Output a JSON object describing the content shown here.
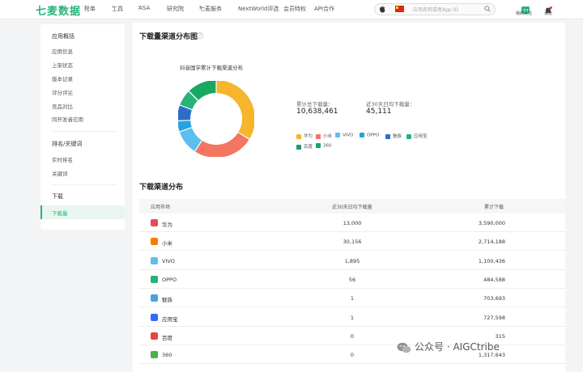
{
  "header": {
    "logo": "七麦数据",
    "nav": [
      "榜单",
      "工具",
      "ASA",
      "研究院",
      "七麦服务",
      "NextWorld评选",
      "会员特权",
      "API合作"
    ],
    "search_placeholder": "应用名称或者App ID",
    "my_follow": "我的关注",
    "messages": "消息",
    "follow_badge": "10"
  },
  "sidebar": {
    "group1_title": "应用概括",
    "group1_items": [
      "应用信息",
      "上架状态",
      "版本记录",
      "评分评论",
      "竞品对比",
      "同开发者应用"
    ],
    "group2_title": "排名/关键词",
    "group2_items": [
      "实时排名",
      "关键词"
    ],
    "group3_title": "下载",
    "group3_items": [
      "下载量"
    ]
  },
  "main": {
    "section1_title": "下载量渠道分布图",
    "chart_title": "抖音国学累计下载渠道分布",
    "total_label": "累计总下载量：",
    "total_value": "10,638,461",
    "avg_label": "近30天日均下载量：",
    "avg_value": "45,111",
    "section2_title": "下载渠道分布"
  },
  "chart_data": {
    "type": "pie",
    "title": "抖音国学累计下载渠道分布",
    "categories": [
      "华为",
      "小米",
      "VIVO",
      "OPPO",
      "魅族",
      "应用宝",
      "百度",
      "360"
    ],
    "values": [
      3590000,
      2714188,
      1100436,
      484588,
      703693,
      727598,
      315,
      1317643
    ],
    "colors": [
      "#f7b52b",
      "#f47560",
      "#5bbfef",
      "#26a4e0",
      "#2a6fc7",
      "#26b37a",
      "#1d9b6c",
      "#17a862"
    ]
  },
  "table": {
    "headers": [
      "应用市场",
      "近30天日均下载量",
      "累计下载"
    ],
    "rows": [
      {
        "name": "华为",
        "avg": "13,000",
        "total": "3,590,000",
        "color": "#e84a5f"
      },
      {
        "name": "小米",
        "avg": "30,156",
        "total": "2,714,188",
        "color": "#f57c00"
      },
      {
        "name": "VIVO",
        "avg": "1,895",
        "total": "1,100,436",
        "color": "#5bbfef"
      },
      {
        "name": "OPPO",
        "avg": "56",
        "total": "484,588",
        "color": "#26b37a"
      },
      {
        "name": "魅族",
        "avg": "1",
        "total": "703,693",
        "color": "#4aa3df"
      },
      {
        "name": "应用宝",
        "avg": "1",
        "total": "727,598",
        "color": "#2f6bff"
      },
      {
        "name": "百度",
        "avg": "0",
        "total": "315",
        "color": "#e6453c"
      },
      {
        "name": "360",
        "avg": "0",
        "total": "1,317,643",
        "color": "#49b04a"
      }
    ]
  },
  "watermark": "公众号 · AIGCtribe"
}
